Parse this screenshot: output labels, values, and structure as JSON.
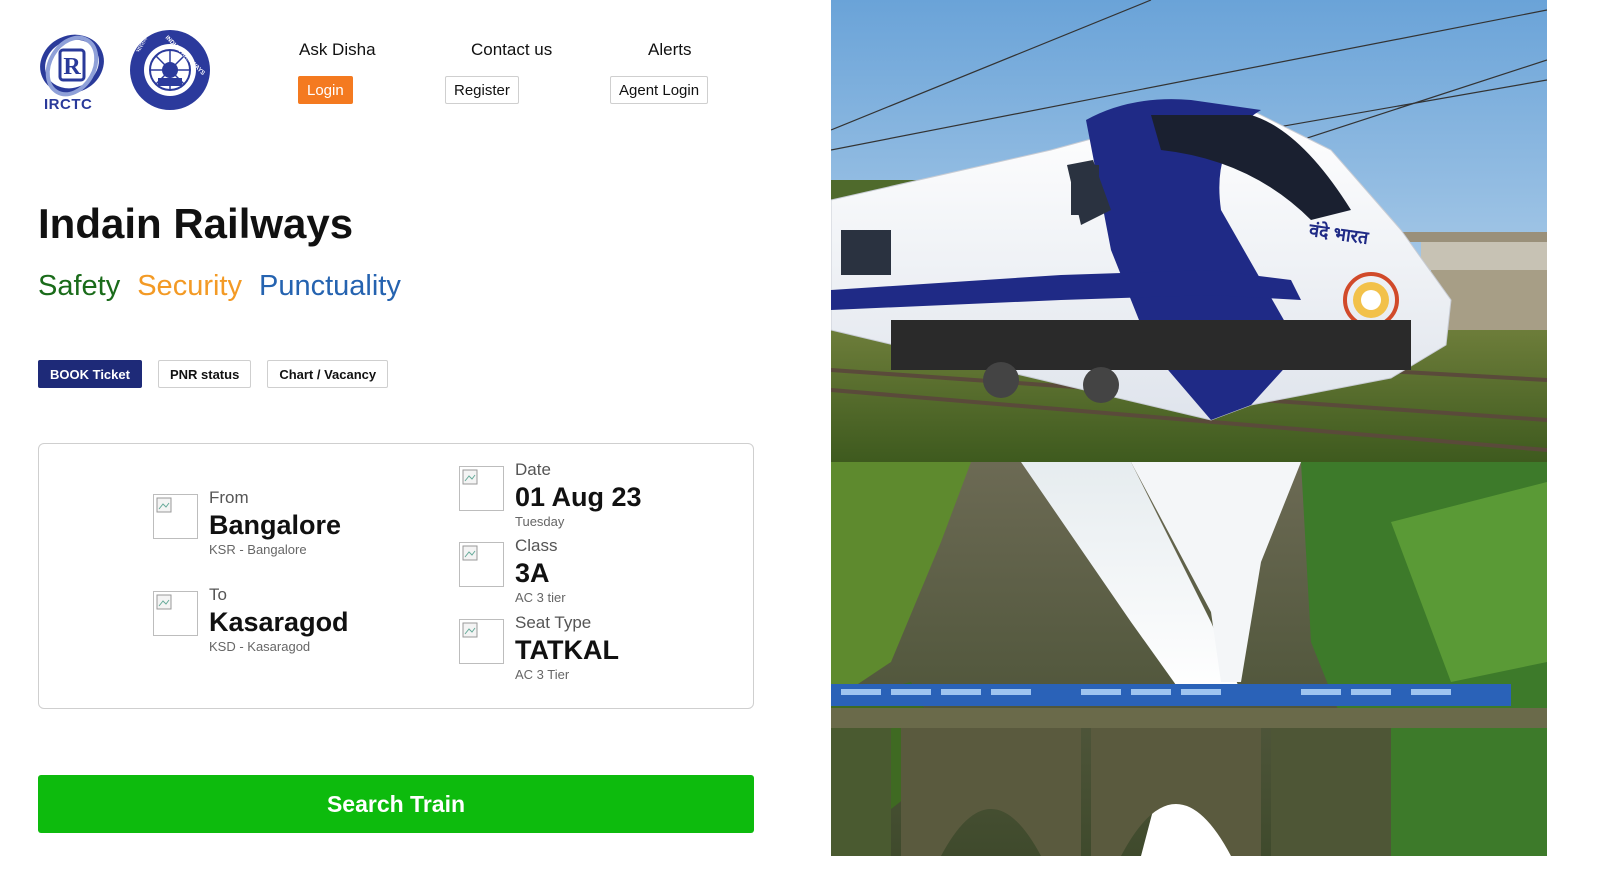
{
  "brand": {
    "irctc_text": "IRCTC",
    "ir_text": "INDIAN RAILWAYS",
    "ir_hindi": "भारतीय रेल"
  },
  "topnav": {
    "links": [
      "Ask Disha",
      "Contact us",
      "Alerts"
    ],
    "buttons": [
      "Login",
      "Register",
      "Agent Login"
    ]
  },
  "hero": {
    "title": "Indain Railways",
    "tagline": [
      "Safety",
      "Security",
      "Punctuality"
    ]
  },
  "tabs": [
    "BOOK Ticket",
    "PNR status",
    "Chart / Vacancy"
  ],
  "booking": {
    "from": {
      "label": "From",
      "value": "Bangalore",
      "sub": "KSR - Bangalore"
    },
    "to": {
      "label": "To",
      "value": "Kasaragod",
      "sub": "KSD - Kasaragod"
    },
    "date": {
      "label": "Date",
      "value": "01 Aug 23",
      "sub": "Tuesday"
    },
    "class": {
      "label": "Class",
      "value": "3A",
      "sub": "AC 3 tier"
    },
    "seat": {
      "label": "Seat Type",
      "value": "TATKAL",
      "sub": "AC 3 Tier"
    }
  },
  "search_label": "Search Train",
  "photos": {
    "top_train_hindi": "वंदे भारत"
  },
  "colors": {
    "login": "#f47a20",
    "tab_active": "#1e2a78",
    "search": "#0dbb0d",
    "safety": "#1a6b1a",
    "security": "#f39a25",
    "punctuality": "#2563b0"
  }
}
